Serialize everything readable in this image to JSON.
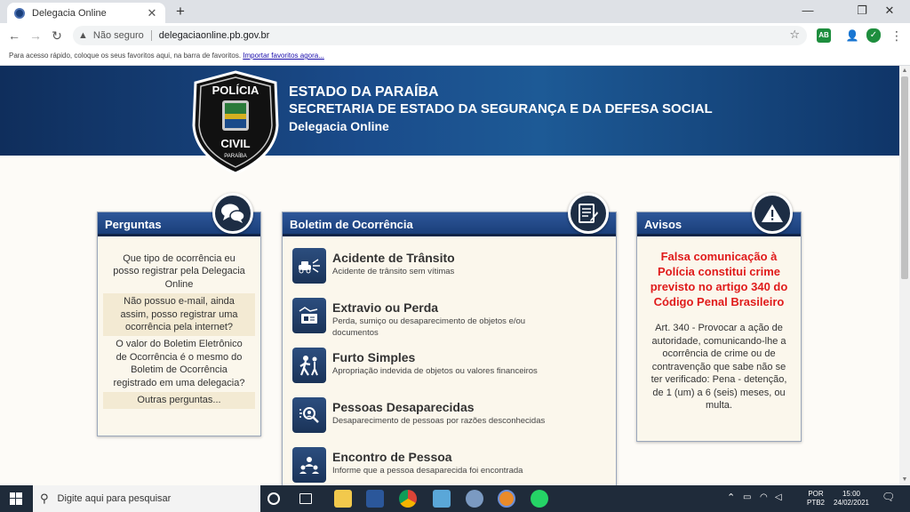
{
  "browser": {
    "tab_title": "Delegacia Online",
    "not_secure": "Não seguro",
    "url": "delegaciaonline.pb.gov.br",
    "bookmarks_text": "Para acesso rápido, coloque os seus favoritos aqui, na barra de favoritos.",
    "bookmarks_link": "Importar favoritos agora...",
    "extension_badge": "AB"
  },
  "header": {
    "badge_top": "POLÍCIA",
    "badge_bottom": "CIVIL",
    "badge_state": "PARAÍBA",
    "state": "ESTADO DA PARAÍBA",
    "secretary": "SECRETARIA DE ESTADO DA SEGURANÇA E DA DEFESA SOCIAL",
    "portal": "Delegacia Online"
  },
  "perguntas": {
    "title": "Perguntas",
    "items": [
      "Que tipo de ocorrência eu posso registrar pela Delegacia Online",
      "Não possuo e-mail, ainda assim, posso registrar uma ocorrência pela internet?",
      "O valor do Boletim Eletrônico de Ocorrência é o mesmo do Boletim de Ocorrência registrado em uma delegacia?",
      "Outras perguntas..."
    ]
  },
  "boletim": {
    "title": "Boletim de Ocorrência",
    "items": [
      {
        "title": "Acidente de Trânsito",
        "desc": "Acidente de trânsito sem vítimas",
        "icon": "car-crash-icon"
      },
      {
        "title": "Extravio ou Perda",
        "desc": "Perda, sumiço ou desaparecimento de objetos e/ou documentos",
        "icon": "lost-documents-icon"
      },
      {
        "title": "Furto Simples",
        "desc": "Apropriação indevida de objetos ou valores financeiros",
        "icon": "theft-icon"
      },
      {
        "title": "Pessoas Desaparecidas",
        "desc": "Desaparecimento de pessoas por razões desconhecidas",
        "icon": "missing-person-icon"
      },
      {
        "title": "Encontro de Pessoa",
        "desc": "Informe que a pessoa desaparecida foi encontrada",
        "icon": "found-person-icon"
      }
    ]
  },
  "avisos": {
    "title": "Avisos",
    "alert": "Falsa comunicação à Polícia constitui crime previsto no artigo 340 do Código Penal Brasileiro",
    "text": "Art. 340 - Provocar a ação de autoridade, comunicando-lhe a ocorrência de crime ou de contravenção que sabe não se ter verificado: Pena - detenção, de 1 (um) a 6 (seis) meses, ou multa."
  },
  "taskbar": {
    "search_placeholder": "Digite aqui para pesquisar",
    "lang_top": "POR",
    "lang_bottom": "PTB2",
    "time": "15:00",
    "date": "24/02/2021"
  },
  "colors": {
    "banner": "#1a4b8a",
    "panel_header": "#1a3f7a",
    "alert_red": "#e01b1b",
    "panel_bg": "#fbf7ec"
  }
}
